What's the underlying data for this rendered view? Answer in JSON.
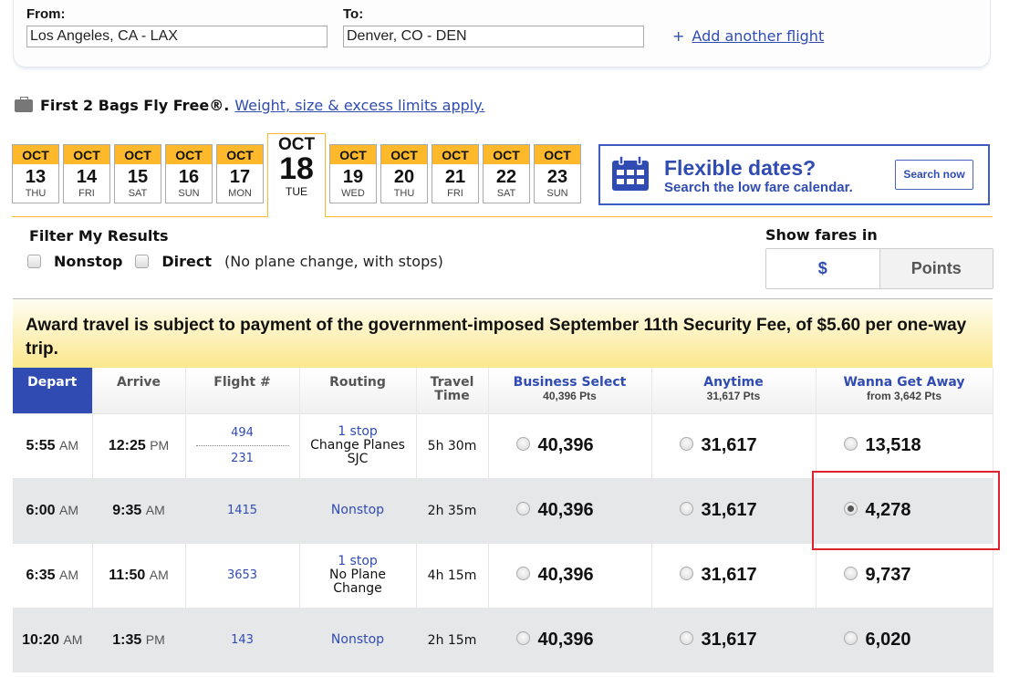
{
  "search": {
    "from_label": "From:",
    "from_value": "Los Angeles, CA - LAX",
    "to_label": "To:",
    "to_value": "Denver, CO - DEN",
    "add_flight_plus": "+",
    "add_flight_label": "Add another flight"
  },
  "bags": {
    "icon": "suitcase-icon",
    "title": "First 2 Bags Fly Free®.",
    "link": "Weight, size & excess limits apply."
  },
  "dates": [
    {
      "month": "OCT",
      "day": "13",
      "dow": "THU"
    },
    {
      "month": "OCT",
      "day": "14",
      "dow": "FRI"
    },
    {
      "month": "OCT",
      "day": "15",
      "dow": "SAT"
    },
    {
      "month": "OCT",
      "day": "16",
      "dow": "SUN"
    },
    {
      "month": "OCT",
      "day": "17",
      "dow": "MON"
    },
    {
      "month": "OCT",
      "day": "18",
      "dow": "TUE",
      "selected": true
    },
    {
      "month": "OCT",
      "day": "19",
      "dow": "WED"
    },
    {
      "month": "OCT",
      "day": "20",
      "dow": "THU"
    },
    {
      "month": "OCT",
      "day": "21",
      "dow": "FRI"
    },
    {
      "month": "OCT",
      "day": "22",
      "dow": "SAT"
    },
    {
      "month": "OCT",
      "day": "23",
      "dow": "SUN"
    }
  ],
  "flexible": {
    "icon": "calendar-icon",
    "title": "Flexible dates?",
    "subtitle": "Search the low fare calendar.",
    "button": "Search now"
  },
  "filter": {
    "title": "Filter My Results",
    "nonstop_label": "Nonstop",
    "direct_label": "Direct",
    "direct_note": "(No plane change, with stops)",
    "nonstop_checked": false,
    "direct_checked": false
  },
  "fares_in": {
    "title": "Show fares in",
    "dollar_label": "$",
    "points_label": "Points",
    "selected": "Points"
  },
  "notice": "Award travel is subject to payment of the government-imposed September 11th Security Fee, of $5.60 per one-way trip.",
  "table": {
    "headers": {
      "depart": "Depart",
      "arrive": "Arrive",
      "flight": "Flight #",
      "routing": "Routing",
      "travel_time_1": "Travel",
      "travel_time_2": "Time",
      "business": "Business Select",
      "business_sub": "40,396 Pts",
      "anytime": "Anytime",
      "anytime_sub": "31,617 Pts",
      "wga": "Wanna Get Away",
      "wga_sub": "from 3,642 Pts"
    },
    "rows": [
      {
        "depart_time": "5:55",
        "depart_ampm": "AM",
        "arrive_time": "12:25",
        "arrive_ampm": "PM",
        "flights": [
          "494",
          "231"
        ],
        "route_stops": "1 stop",
        "route_detail_1": "Change Planes",
        "route_detail_2": "SJC",
        "travel": "5h 30m",
        "business": "40,396",
        "anytime": "31,617",
        "wga": "13,518",
        "selected": null
      },
      {
        "depart_time": "6:00",
        "depart_ampm": "AM",
        "arrive_time": "9:35",
        "arrive_ampm": "AM",
        "flights": [
          "1415"
        ],
        "route_nonstop": "Nonstop",
        "travel": "2h 35m",
        "business": "40,396",
        "anytime": "31,617",
        "wga": "4,278",
        "selected": "wga"
      },
      {
        "depart_time": "6:35",
        "depart_ampm": "AM",
        "arrive_time": "11:50",
        "arrive_ampm": "AM",
        "flights": [
          "3653"
        ],
        "route_stops": "1 stop",
        "route_detail_1": "No Plane",
        "route_detail_2": "Change",
        "travel": "4h 15m",
        "business": "40,396",
        "anytime": "31,617",
        "wga": "9,737",
        "selected": null
      },
      {
        "depart_time": "10:20",
        "depart_ampm": "AM",
        "arrive_time": "1:35",
        "arrive_ampm": "PM",
        "flights": [
          "143"
        ],
        "route_nonstop": "Nonstop",
        "travel": "2h 15m",
        "business": "40,396",
        "anytime": "31,617",
        "wga": "6,020",
        "selected": null
      }
    ]
  },
  "colors": {
    "brand_blue": "#304cb2",
    "gold": "#fdb92b",
    "highlight_red": "#e0202c"
  }
}
